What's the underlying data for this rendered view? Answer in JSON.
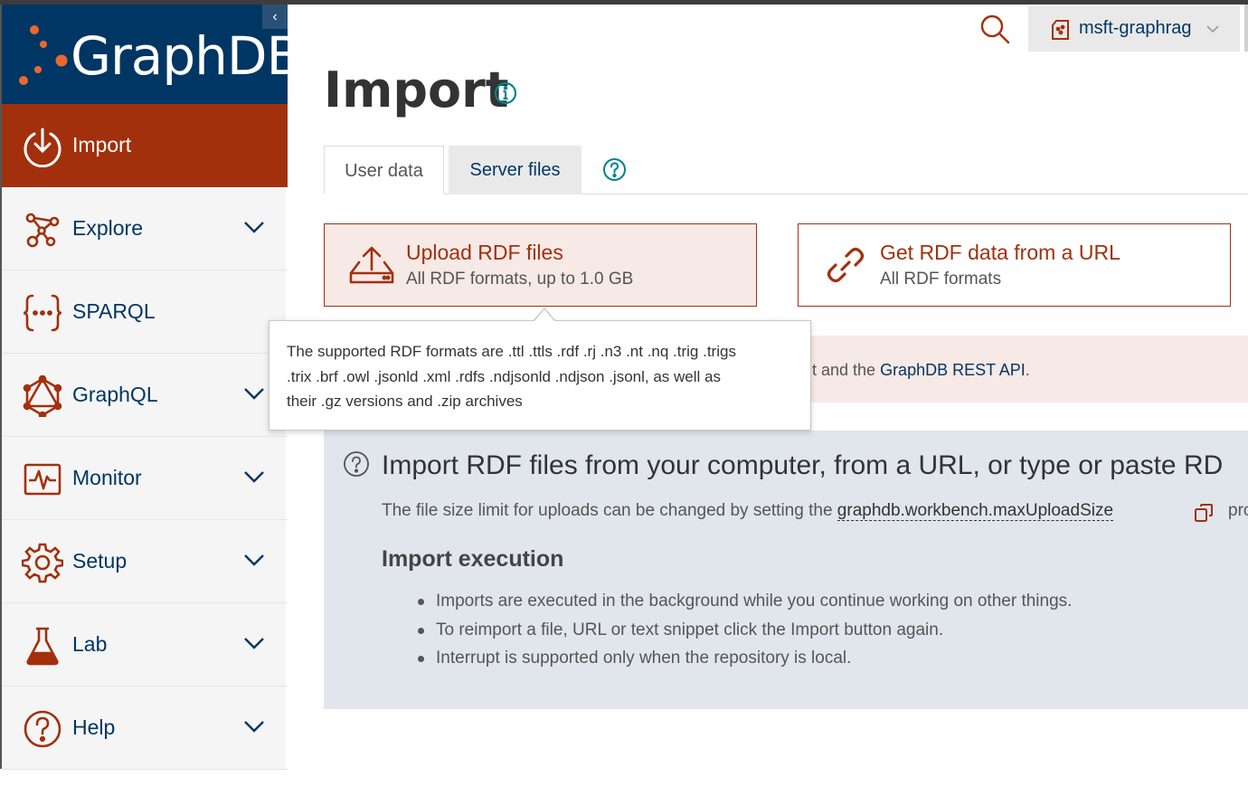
{
  "brand": {
    "name": "GraphDB",
    "collapse_glyph": "‹"
  },
  "sidebar": {
    "items": [
      {
        "label": "Import",
        "icon": "import-icon",
        "active": true
      },
      {
        "label": "Explore",
        "icon": "explore-icon",
        "expandable": true
      },
      {
        "label": "SPARQL",
        "icon": "sparql-icon",
        "expandable": false
      },
      {
        "label": "GraphQL",
        "icon": "graphql-icon",
        "expandable": true
      },
      {
        "label": "Monitor",
        "icon": "monitor-icon",
        "expandable": true
      },
      {
        "label": "Setup",
        "icon": "gear-icon",
        "expandable": true
      },
      {
        "label": "Lab",
        "icon": "flask-icon",
        "expandable": true
      },
      {
        "label": "Help",
        "icon": "help-icon",
        "expandable": true
      }
    ]
  },
  "header": {
    "repository": "msft-graphrag",
    "search_icon": "search-icon"
  },
  "page": {
    "title": "Import"
  },
  "tabs": [
    {
      "label": "User data",
      "active": true
    },
    {
      "label": "Server files",
      "active": false
    }
  ],
  "cards": {
    "upload": {
      "title": "Upload RDF files",
      "subtitle": "All RDF formats, up to 1.0 GB"
    },
    "url": {
      "title": "Get RDF data from a URL",
      "subtitle": "All RDF formats"
    }
  },
  "alert": {
    "text_prefix": "t and the ",
    "link": "GraphDB REST API",
    "text_suffix": "."
  },
  "tooltip": {
    "lines": [
      "The supported RDF formats are .ttl .ttls .rdf .rj .n3 .nt .nq .trig .trigs",
      ".trix .brf .owl .jsonld .xml .rdfs .ndjsonld .ndjson .jsonl, as well as",
      "their .gz versions and .zip archives"
    ]
  },
  "info": {
    "heading": "Import RDF files from your computer, from a URL, or type or paste RD",
    "size_text": "The file size limit for uploads can be changed by setting the ",
    "size_property": "graphdb.workbench.maxUploadSize",
    "size_tail": "pro",
    "exec_heading": "Import execution",
    "exec_items": [
      "Imports are executed in the background while you continue working on other things.",
      "To reimport a file, URL or text snippet click the Import button again.",
      "Interrupt is supported only when the repository is local."
    ]
  },
  "colors": {
    "brand_navy": "#003663",
    "accent_red": "#a2300d",
    "orange": "#ea6830",
    "teal": "#00838f"
  }
}
